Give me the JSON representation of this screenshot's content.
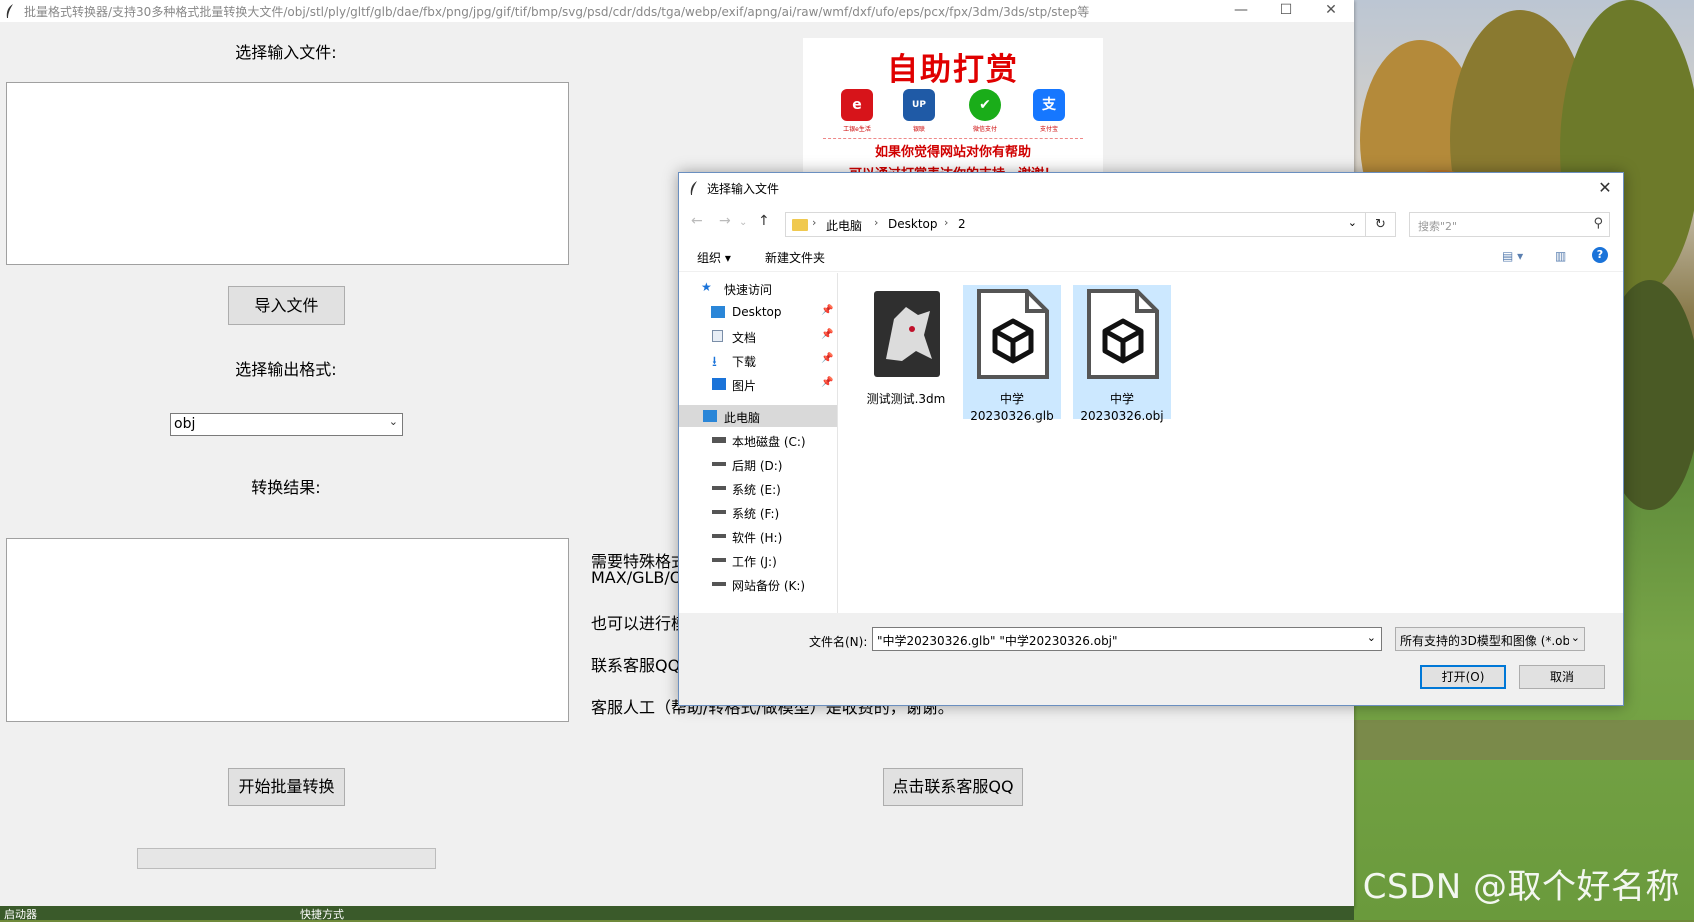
{
  "app": {
    "title": "批量格式转换器/支持30多种格式批量转换大文件/obj/stl/ply/gltf/glb/dae/fbx/png/jpg/gif/tif/bmp/svg/psd/cdr/dds/tga/webp/exif/apng/ai/raw/wmf/dxf/ufo/eps/pcx/fpx/3dm/3ds/stp/step等",
    "controls": {
      "minimize": "—",
      "maximize": "☐",
      "close": "✕"
    },
    "input_label": "选择输入文件:",
    "import_button": "导入文件",
    "output_label": "选择输出格式:",
    "format_select": {
      "value": "obj"
    },
    "result_label": "转换结果:",
    "start_button": "开始批量转换",
    "contact_button": "点击联系客服QQ",
    "info_lines": [
      "需要特殊格式",
      "MAX/GLB/O",
      "也可以进行模",
      "联系客服QQ",
      "客服人工（帮助/转格式/做模型）是收费的，谢谢。"
    ],
    "progress": 0
  },
  "donate": {
    "title": "自助打赏",
    "methods": [
      {
        "icon": "icbc-pay-icon",
        "caption": "工银e生活",
        "color": "#d7141a"
      },
      {
        "icon": "unionpay-icon",
        "caption": "银联",
        "color": "#1f5aa6"
      },
      {
        "icon": "wechat-pay-icon",
        "caption": "微信支付",
        "color": "#1aad19"
      },
      {
        "icon": "alipay-icon",
        "caption": "支付宝",
        "color": "#1677ff"
      }
    ],
    "line1": "如果你觉得网站对你有帮助",
    "line2": "可以通过打赏表达你的支持，谢谢！"
  },
  "dialog": {
    "title": "选择输入文件",
    "address": {
      "crumbs": [
        "此电脑",
        "Desktop",
        "2"
      ]
    },
    "search_placeholder": "搜索\"2\"",
    "commands": {
      "organize": "组织 ▾",
      "new_folder": "新建文件夹"
    },
    "nav": {
      "quick_access": "快速访问",
      "pinned": [
        "Desktop",
        "文档",
        "下载",
        "图片"
      ],
      "this_pc": "此电脑",
      "drives": [
        "本地磁盘 (C:)",
        "后期 (D:)",
        "系统 (E:)",
        "系统 (F:)",
        "软件 (H:)",
        "工作 (J:)",
        "网站备份 (K:)"
      ]
    },
    "files": [
      {
        "name": "测试测试.3dm",
        "selected": false
      },
      {
        "name": "中学20230326.glb",
        "selected": true
      },
      {
        "name": "中学20230326.obj",
        "selected": true
      }
    ],
    "filename_label": "文件名(N):",
    "filename_value": "\"中学20230326.glb\" \"中学20230326.obj\"",
    "filetype_value": "所有支持的3D模型和图像 (*.ob",
    "open_button": "打开(O)",
    "cancel_button": "取消"
  },
  "taskbar": {
    "items": [
      "启动器",
      "快捷方式"
    ]
  },
  "watermark": "CSDN @取个好名称"
}
